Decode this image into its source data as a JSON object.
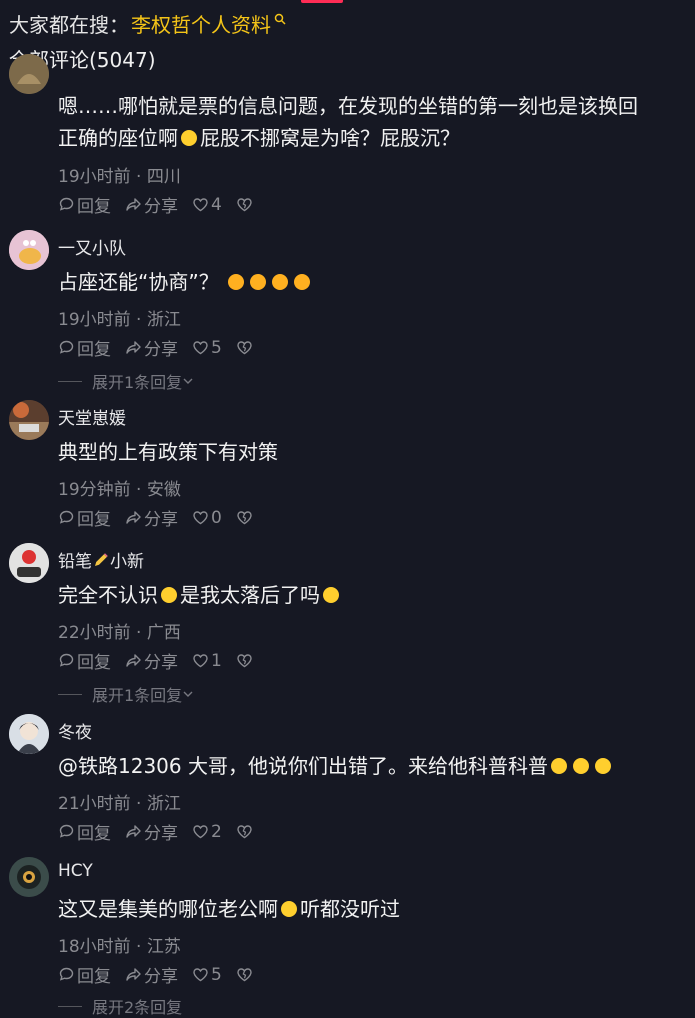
{
  "top_search": {
    "prefix": "大家都在搜：",
    "keyword": "李权哲个人资料"
  },
  "comments_header": "全部评论(5047)",
  "comments": [
    {
      "username": "",
      "text_line1": "嗯……哪怕就是票的信息问题，在发现的坐错的第一刻也是该换回",
      "text_line2": "正确的座位啊",
      "text_line2_after": "屁股不挪窝是为啥？屁股沉？",
      "meta": "19小时前 · 四川",
      "reply": "回复",
      "share": "分享",
      "likes": "4"
    },
    {
      "username": "一又小队",
      "text": "占座还能“协商”？",
      "meta": "19小时前 · 浙江",
      "reply": "回复",
      "share": "分享",
      "likes": "5",
      "expand": "展开1条回复"
    },
    {
      "username": "天堂崽媛",
      "text": "典型的上有政策下有对策",
      "meta": "19分钟前 · 安徽",
      "reply": "回复",
      "share": "分享",
      "likes": "0"
    },
    {
      "username_a": "铅笔",
      "username_b": "小新",
      "text": "完全不认识",
      "text_after": "是我太落后了吗",
      "meta": "22小时前 · 广西",
      "reply": "回复",
      "share": "分享",
      "likes": "1",
      "expand": "展开1条回复"
    },
    {
      "username": "冬夜",
      "text": "@铁路12306 大哥，他说你们出错了。来给他科普科普",
      "meta": "21小时前 · 浙江",
      "reply": "回复",
      "share": "分享",
      "likes": "2"
    },
    {
      "username": "HCY",
      "text": "这又是集美的哪位老公啊",
      "text_after": "听都没听过",
      "meta": "18小时前 · 江苏",
      "reply": "回复",
      "share": "分享",
      "likes": "5",
      "expand": "展开2条回复"
    }
  ]
}
